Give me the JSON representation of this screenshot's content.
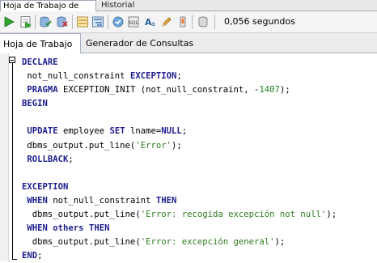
{
  "tabs": [
    {
      "label": "Hoja de Trabajo de SQL",
      "active": true
    },
    {
      "label": "Historial",
      "active": false
    }
  ],
  "toolbar": {
    "icons": [
      "run-statement-icon",
      "run-script-icon",
      "commit-icon",
      "rollback-icon",
      "autotrace-icon",
      "explain-plan-icon",
      "tuning-icon",
      "sql-history-icon",
      "format-icon",
      "clear-icon",
      "unshared-sql-icon"
    ],
    "execution_time": "0,056 segundos"
  },
  "subtabs": [
    {
      "label": "Hoja de Trabajo",
      "active": true
    },
    {
      "label": "Generador de Consultas",
      "active": false
    }
  ],
  "code": [
    [
      {
        "t": "DECLARE",
        "k": "kw"
      }
    ],
    [
      {
        "t": " not_null_constraint ",
        "k": "p"
      },
      {
        "t": "EXCEPTION",
        "k": "kw"
      },
      {
        "t": ";",
        "k": "p"
      }
    ],
    [
      {
        "t": " ",
        "k": "p"
      },
      {
        "t": "PRAGMA",
        "k": "kw"
      },
      {
        "t": " EXCEPTION_INIT (not_null_constraint, -",
        "k": "p"
      },
      {
        "t": "1407",
        "k": "num"
      },
      {
        "t": ");",
        "k": "p"
      }
    ],
    [
      {
        "t": "BEGIN",
        "k": "kw"
      }
    ],
    [
      {
        "t": "",
        "k": "p"
      }
    ],
    [
      {
        "t": " ",
        "k": "p"
      },
      {
        "t": "UPDATE",
        "k": "kw"
      },
      {
        "t": " employee ",
        "k": "p"
      },
      {
        "t": "SET",
        "k": "kw"
      },
      {
        "t": " lname=",
        "k": "p"
      },
      {
        "t": "NULL",
        "k": "kw"
      },
      {
        "t": ";",
        "k": "p"
      }
    ],
    [
      {
        "t": " dbms_output.put_line(",
        "k": "p"
      },
      {
        "t": "'Error'",
        "k": "str"
      },
      {
        "t": ");",
        "k": "p"
      }
    ],
    [
      {
        "t": " ",
        "k": "p"
      },
      {
        "t": "ROLLBACK",
        "k": "kw"
      },
      {
        "t": ";",
        "k": "p"
      }
    ],
    [
      {
        "t": "",
        "k": "p"
      }
    ],
    [
      {
        "t": "EXCEPTION",
        "k": "kw"
      }
    ],
    [
      {
        "t": " ",
        "k": "p"
      },
      {
        "t": "WHEN",
        "k": "kw"
      },
      {
        "t": " not_null_constraint ",
        "k": "p"
      },
      {
        "t": "THEN",
        "k": "kw"
      }
    ],
    [
      {
        "t": "  dbms_output.put_line(",
        "k": "p"
      },
      {
        "t": "'Error: recogida excepción not null'",
        "k": "str"
      },
      {
        "t": ");",
        "k": "p"
      }
    ],
    [
      {
        "t": " ",
        "k": "p"
      },
      {
        "t": "WHEN",
        "k": "kw"
      },
      {
        "t": " ",
        "k": "p"
      },
      {
        "t": "others",
        "k": "kw"
      },
      {
        "t": " ",
        "k": "p"
      },
      {
        "t": "THEN",
        "k": "kw"
      }
    ],
    [
      {
        "t": "  dbms_output.put_line(",
        "k": "p"
      },
      {
        "t": "'Error: excepción general'",
        "k": "str"
      },
      {
        "t": ");",
        "k": "p"
      }
    ],
    [
      {
        "t": "END",
        "k": "kw"
      },
      {
        "t": ";",
        "k": "p"
      }
    ]
  ],
  "colors": {
    "keyword": "#1d1d8f",
    "string": "#2f7d1f",
    "number": "#1e7e1e"
  }
}
